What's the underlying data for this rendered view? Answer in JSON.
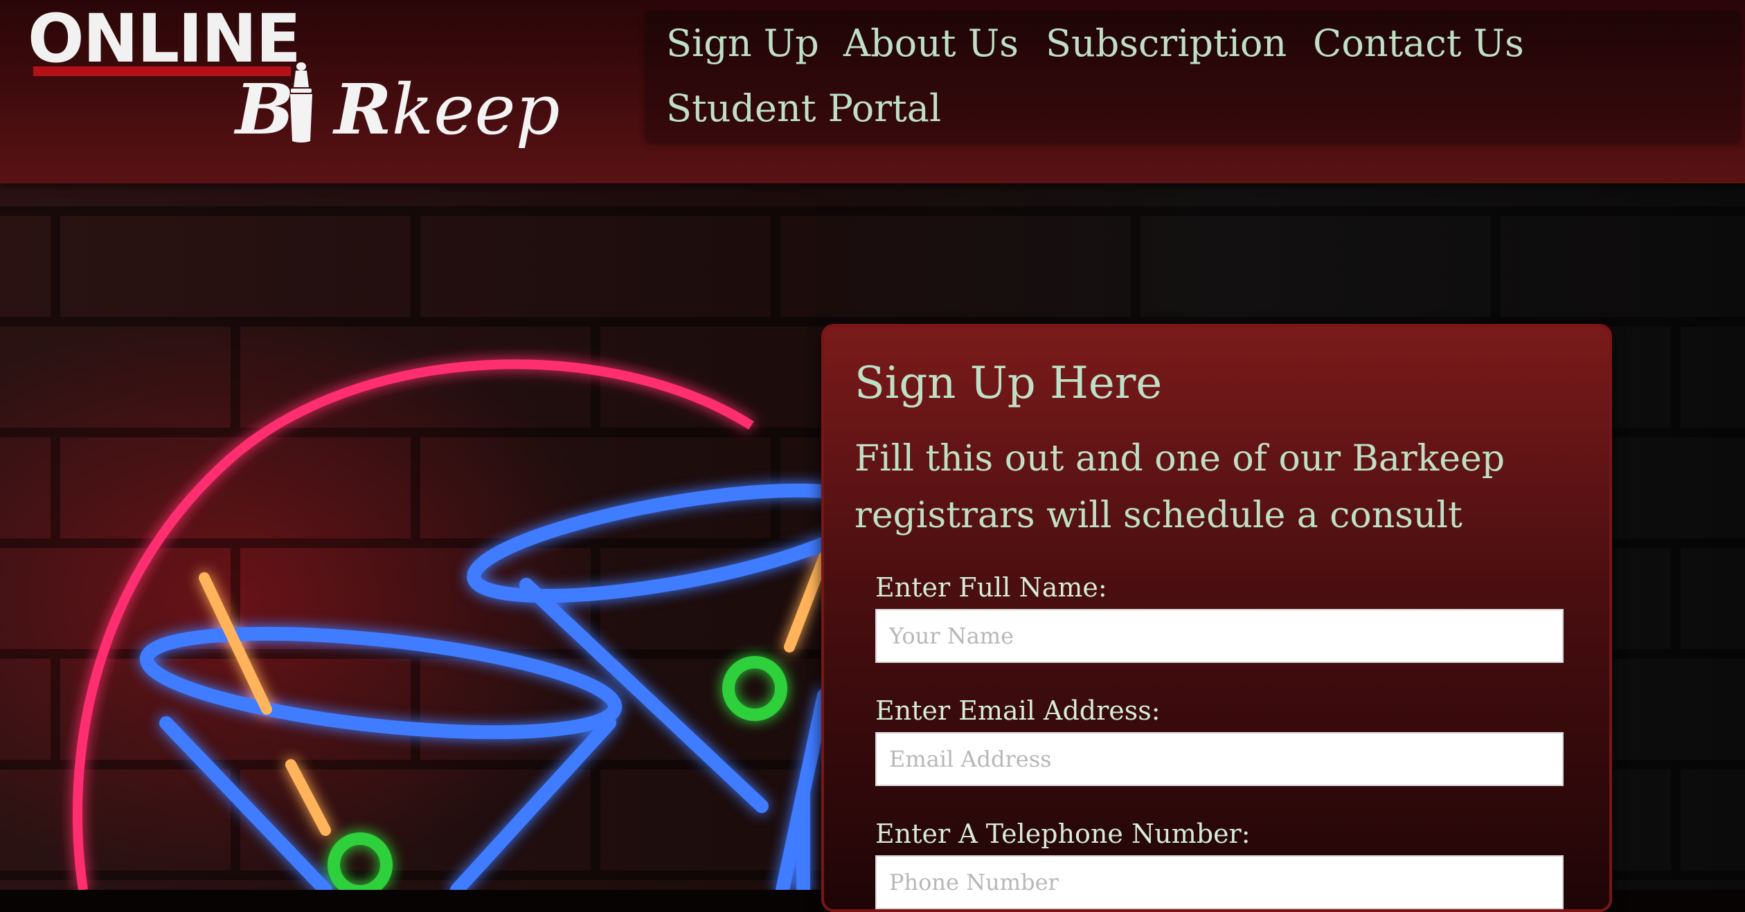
{
  "logo": {
    "online": "ONLINE",
    "barkeep_b": "B",
    "barkeep_r": "R",
    "barkeep_keep": "keep"
  },
  "nav": {
    "items": [
      {
        "label": "Sign Up"
      },
      {
        "label": "About Us"
      },
      {
        "label": "Subscription"
      },
      {
        "label": "Contact Us"
      },
      {
        "label": "Student Portal"
      }
    ]
  },
  "form": {
    "title": "Sign Up Here",
    "subtitle": "Fill this out and one of our Barkeep registrars will schedule a consult",
    "fields": [
      {
        "label": "Enter Full Name:",
        "placeholder": "Your Name",
        "value": ""
      },
      {
        "label": "Enter Email Address:",
        "placeholder": "Email Address",
        "value": ""
      },
      {
        "label": "Enter A Telephone Number:",
        "placeholder": "Phone Number",
        "value": ""
      }
    ]
  },
  "colors": {
    "header_bg": "#3b0a0c",
    "nav_text": "#bfe0c6",
    "logo_red": "#b31017",
    "form_bg": "#7a1a1a",
    "neon_pink": "#ff2d6f",
    "neon_blue": "#3f7bff",
    "neon_green": "#2fd03a",
    "neon_orange": "#ffb35a"
  },
  "icons": {
    "logo_shaker": "cocktail-shaker-icon"
  }
}
